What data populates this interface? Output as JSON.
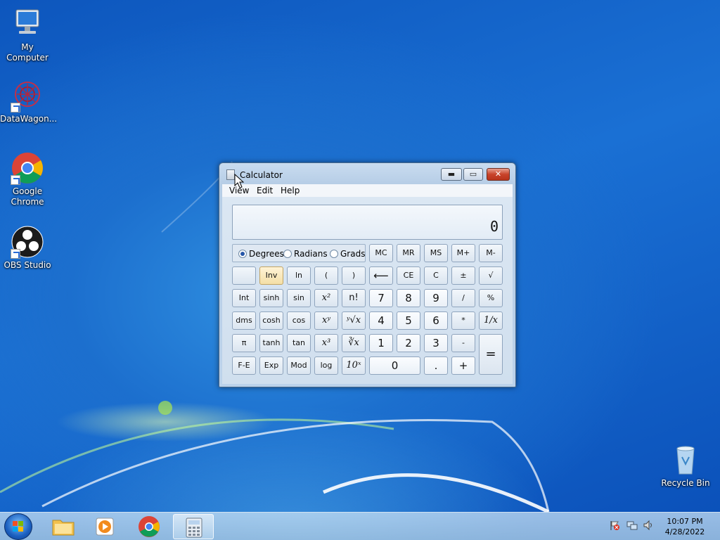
{
  "desktop": {
    "icons": [
      {
        "label": "My Computer",
        "icon": "computer-icon"
      },
      {
        "label": "DataWagon...",
        "icon": "datawagon-icon"
      },
      {
        "label": "Google Chrome",
        "icon": "chrome-icon"
      },
      {
        "label": "OBS Studio",
        "icon": "obs-icon"
      },
      {
        "label": "Recycle Bin",
        "icon": "recycle-bin-icon"
      }
    ]
  },
  "calculator": {
    "title": "Calculator",
    "menu": [
      "View",
      "Edit",
      "Help"
    ],
    "display": "0",
    "angle_modes": [
      "Degrees",
      "Radians",
      "Grads"
    ],
    "selected_angle": "Degrees",
    "memory_keys": [
      "MC",
      "MR",
      "MS",
      "M+",
      "M-"
    ],
    "row1": [
      "",
      "Inv",
      "ln",
      "(",
      ")",
      "⟵",
      "CE",
      "C",
      "±",
      "√"
    ],
    "row2": [
      "Int",
      "sinh",
      "sin",
      "x²",
      "n!",
      "7",
      "8",
      "9",
      "/",
      "%"
    ],
    "row3": [
      "dms",
      "cosh",
      "cos",
      "xʸ",
      "ʸ√x",
      "4",
      "5",
      "6",
      "*",
      "1/x"
    ],
    "row4": [
      "π",
      "tanh",
      "tan",
      "x³",
      "∛x",
      "1",
      "2",
      "3",
      "-",
      "="
    ],
    "row5": [
      "F-E",
      "Exp",
      "Mod",
      "log",
      "10ˣ",
      "0",
      ".",
      "+"
    ]
  },
  "taskbar": {
    "items": [
      "start-orb",
      "file-explorer",
      "media-player",
      "chrome",
      "calculator"
    ],
    "time": "10:07 PM",
    "date": "4/28/2022"
  },
  "colors": {
    "accent": "#1c6fce",
    "close": "#c8432a"
  }
}
